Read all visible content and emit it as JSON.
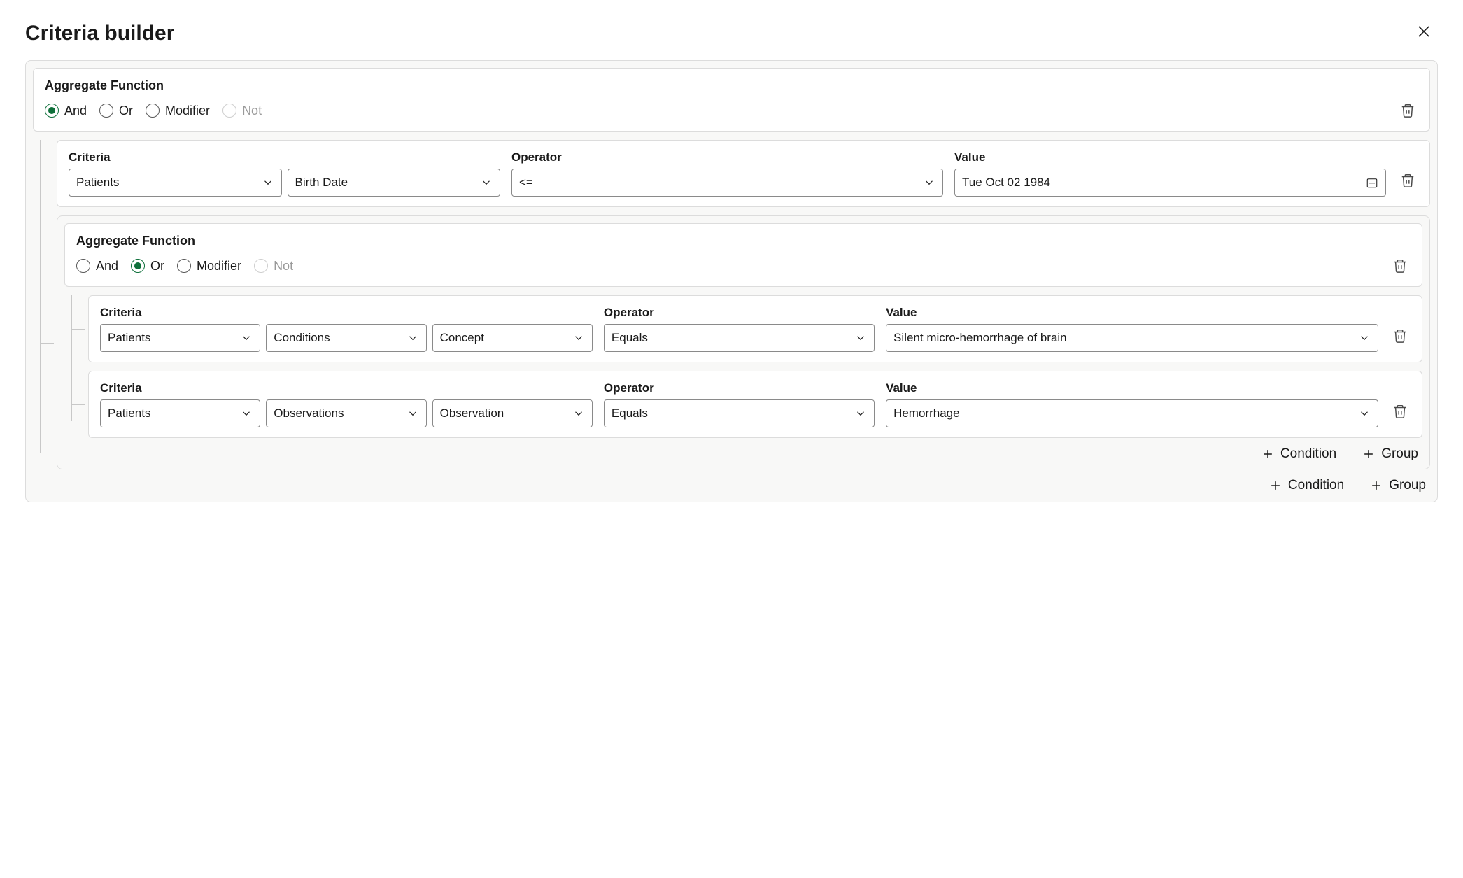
{
  "title": "Criteria builder",
  "labels": {
    "aggregateFunction": "Aggregate Function",
    "criteria": "Criteria",
    "operator": "Operator",
    "value": "Value",
    "condition": "Condition",
    "group": "Group"
  },
  "radioOptions": {
    "and": "And",
    "or": "Or",
    "modifier": "Modifier",
    "not": "Not"
  },
  "rootGroup": {
    "selected": "And",
    "children": {
      "row1": {
        "criteria1": "Patients",
        "criteria2": "Birth Date",
        "operator": "<=",
        "value": "Tue Oct 02 1984"
      },
      "subgroup": {
        "selected": "Or",
        "rowA": {
          "criteria1": "Patients",
          "criteria2": "Conditions",
          "criteria3": "Concept",
          "operator": "Equals",
          "value": "Silent micro-hemorrhage of brain"
        },
        "rowB": {
          "criteria1": "Patients",
          "criteria2": "Observations",
          "criteria3": "Observation",
          "operator": "Equals",
          "value": "Hemorrhage"
        }
      }
    }
  }
}
